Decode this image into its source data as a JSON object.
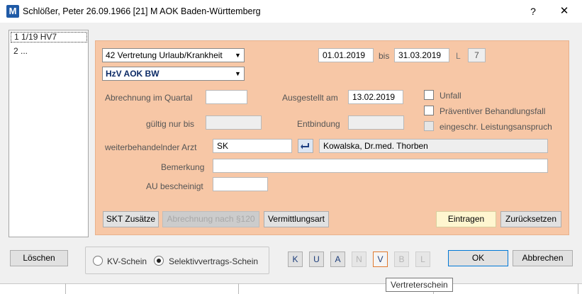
{
  "window": {
    "title": "Schlößer, Peter 26.09.1966  [21]  M AOK Baden-Württemberg",
    "app_icon": "app-logo-icon",
    "help": "?",
    "close": "✕"
  },
  "list": {
    "items": [
      {
        "label": "1  1/19 HV7",
        "selected": true
      },
      {
        "label": "2  ..."
      }
    ]
  },
  "form": {
    "schein_type": "42 Vertretung Urlaub/Krankheit",
    "contract": "HzV AOK BW",
    "date_from": "01.01.2019",
    "bis_label": "bis",
    "date_to": "31.03.2019",
    "l_label": "L",
    "l_value": "7",
    "abrechnung_label": "Abrechnung im Quartal",
    "abrechnung_value": "",
    "ausgestellt_label": "Ausgestellt am",
    "ausgestellt_value": "13.02.2019",
    "gueltig_label": "gültig nur bis",
    "gueltig_value": "",
    "entbindung_label": "Entbindung",
    "entbindung_value": "",
    "checkboxes": {
      "unfall": "Unfall",
      "praeventiv": "Präventiver Behandlungsfall",
      "eingeschr": "eingeschr. Leistungsanspruch"
    },
    "arzt_label": "weiterbehandelnder Arzt",
    "arzt_code": "SK",
    "arzt_name": "Kowalska, Dr.med. Thorben",
    "bemerkung_label": "Bemerkung",
    "bemerkung_value": "",
    "au_label": "AU bescheinigt",
    "au_value": ""
  },
  "panel_buttons": {
    "skt": "SKT Zusätze",
    "abrechnung120": "Abrechnung nach §120",
    "vermittlung": "Vermittlungsart",
    "eintragen": "Eintragen",
    "zuruecksetzen": "Zurücksetzen"
  },
  "bottom": {
    "loeschen": "Löschen",
    "radio_kv": "KV-Schein",
    "radio_selektiv": "Selektivvertrags-Schein",
    "selected_radio": "selektiv",
    "letters": [
      "K",
      "U",
      "A",
      "N",
      "V",
      "B",
      "L"
    ],
    "ok": "OK",
    "abbrechen": "Abbrechen"
  },
  "tooltip": "Vertreterschein",
  "colors": {
    "panel": "#f7c7a6",
    "contract_text": "#0b2a66",
    "focus_outline": "#e07a30",
    "default_button_border": "#0078d7"
  }
}
